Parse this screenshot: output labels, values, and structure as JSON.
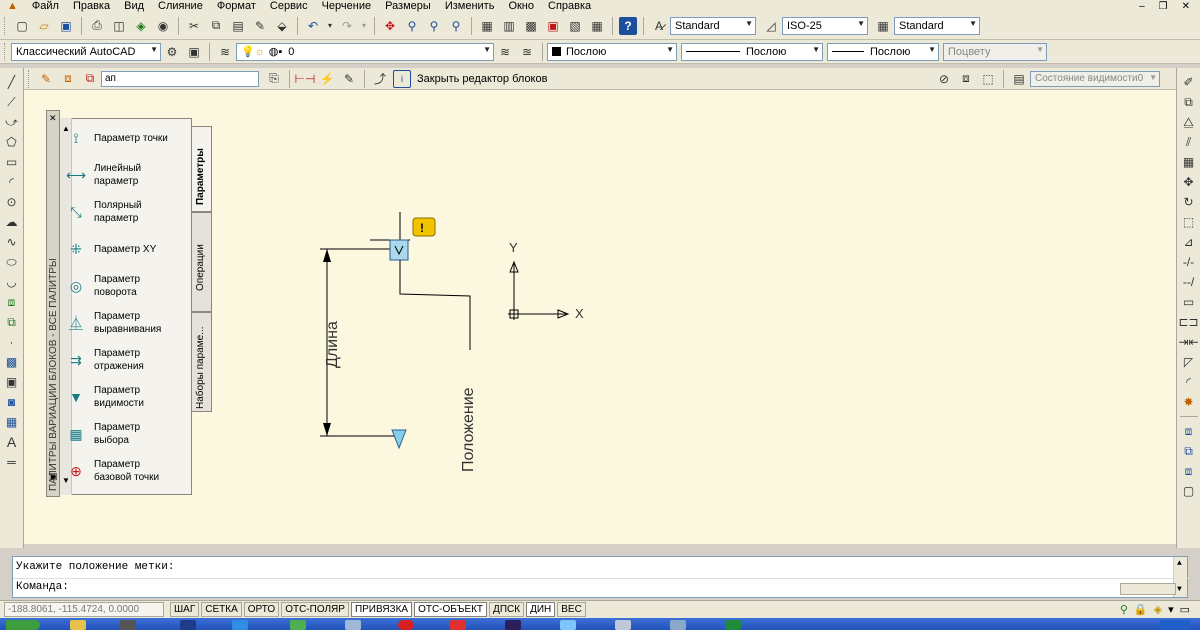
{
  "menu": {
    "items": [
      "Файл",
      "Правка",
      "Вид",
      "Слияние",
      "Формат",
      "Сервис",
      "Черчение",
      "Размеры",
      "Изменить",
      "Окно",
      "Справка"
    ]
  },
  "toolbar1": {
    "text_style": "Standard",
    "dim_style": "ISO-25",
    "table_style": "Standard"
  },
  "toolbar2": {
    "workspace": "Классический AutoCAD",
    "layer": "0",
    "color": "Послою",
    "linetype": "Послою",
    "lineweight": "Послою",
    "plotstyle": "Поцвету"
  },
  "block_editor": {
    "block_name": "ап",
    "close_label": "Закрыть редактор блоков",
    "visibility_state": "Состояние видимости0"
  },
  "palette": {
    "title": "ПАЛИТРЫ ВАРИАЦИИ БЛОКОВ - ВСЕ ПАЛИТРЫ",
    "tabs": [
      "Параметры",
      "Операции",
      "Наборы параме..."
    ],
    "items": [
      {
        "label": "Параметр точки",
        "icon": "point-parameter-icon"
      },
      {
        "label": "Линейный параметр",
        "icon": "linear-parameter-icon"
      },
      {
        "label": "Полярный параметр",
        "icon": "polar-parameter-icon"
      },
      {
        "label": "Параметр XY",
        "icon": "xy-parameter-icon"
      },
      {
        "label": "Параметр поворота",
        "icon": "rotation-parameter-icon"
      },
      {
        "label": "Параметр выравнивания",
        "icon": "alignment-parameter-icon"
      },
      {
        "label": "Параметр отражения",
        "icon": "flip-parameter-icon"
      },
      {
        "label": "Параметр видимости",
        "icon": "visibility-parameter-icon"
      },
      {
        "label": "Параметр выбора",
        "icon": "lookup-parameter-icon"
      },
      {
        "label": "Параметр базовой точки",
        "icon": "basepoint-parameter-icon"
      }
    ]
  },
  "drawing": {
    "length_label": "Длина",
    "position_label": "Положение",
    "axis_y": "Y",
    "axis_x": "X"
  },
  "command": {
    "line1": "Укажите положение метки:",
    "line2": "Команда:"
  },
  "status": {
    "coords": "-188.8061, -115.4724, 0.0000",
    "buttons": [
      "ШАГ",
      "СЕТКА",
      "ОРТО",
      "ОТС-ПОЛЯР",
      "ПРИВЯЗКА",
      "ОТС-ОБЪЕКТ",
      "ДПСК",
      "ДИН",
      "ВЕС"
    ]
  }
}
